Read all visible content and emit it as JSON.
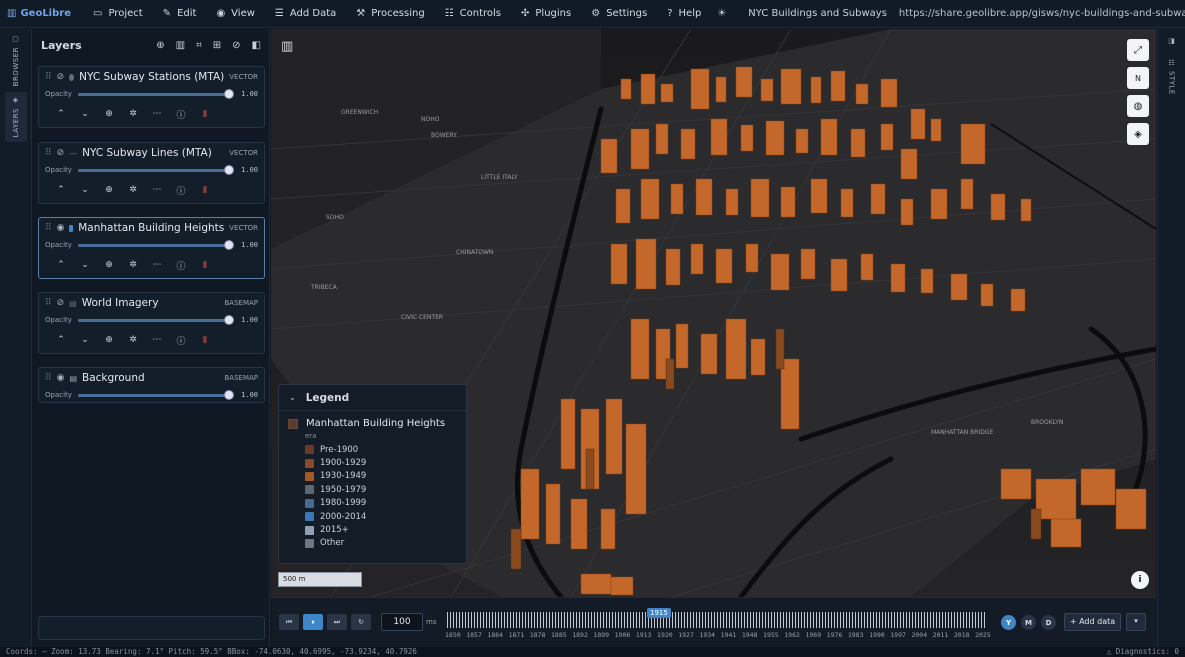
{
  "app": {
    "brand": "GeoLibre"
  },
  "menu": [
    {
      "label": "Project",
      "icon": "folder-icon"
    },
    {
      "label": "Edit",
      "icon": "pencil-icon"
    },
    {
      "label": "View",
      "icon": "eye-icon"
    },
    {
      "label": "Add Data",
      "icon": "database-icon"
    },
    {
      "label": "Processing",
      "icon": "wrench-icon"
    },
    {
      "label": "Controls",
      "icon": "sliders-icon"
    },
    {
      "label": "Plugins",
      "icon": "puzzle-icon"
    },
    {
      "label": "Settings",
      "icon": "gear-icon"
    },
    {
      "label": "Help",
      "icon": "help-icon"
    }
  ],
  "share": {
    "title": "NYC Buildings and Subways",
    "url": "https://share.geolibre.app/gisws/nyc-buildings-and-subways.geolibre.j..."
  },
  "leftrail": {
    "browser": "BROWSER",
    "layers": "LAYERS"
  },
  "panel": {
    "title": "Layers",
    "opacity_label": "Opacity"
  },
  "layers": [
    {
      "name": "NYC Subway Stations (MTA)",
      "type": "VECTOR",
      "opacity": "1.00",
      "opacity_value": 1.0,
      "visible": false,
      "swatch": "#666d77"
    },
    {
      "name": "NYC Subway Lines (MTA)",
      "type": "VECTOR",
      "opacity": "1.00",
      "opacity_value": 1.0,
      "visible": false,
      "swatch": "#666d77"
    },
    {
      "name": "Manhattan Building Heights",
      "type": "VECTOR",
      "opacity": "1.00",
      "opacity_value": 1.0,
      "visible": true,
      "swatch": "#3f86c8"
    },
    {
      "name": "World Imagery",
      "type": "BASEMAP",
      "opacity": "1.00",
      "opacity_value": 1.0,
      "visible": false,
      "swatch": "#666d77"
    },
    {
      "name": "Background",
      "type": "BASEMAP",
      "opacity": "1.00",
      "opacity_value": 1.0,
      "visible": true,
      "swatch": "#666d77"
    }
  ],
  "rightrail": {
    "style": "STYLE"
  },
  "map_labels": [
    "GREENWICH",
    "NOHO",
    "BOWERY",
    "SOHO",
    "LITTLE ITALY",
    "TRIBECA",
    "CHINATOWN",
    "CIVIC CENTER",
    "MANHATTAN BRIDGE",
    "BROOKLYN"
  ],
  "legend": {
    "header": "Legend",
    "layer": "Manhattan Building Heights",
    "field": "era",
    "items": [
      {
        "label": "Pre-1900",
        "color": "#6b3a26"
      },
      {
        "label": "1900-1929",
        "color": "#8a4a26"
      },
      {
        "label": "1930-1949",
        "color": "#a45a24"
      },
      {
        "label": "1950-1979",
        "color": "#5d6673"
      },
      {
        "label": "1980-1999",
        "color": "#476b93"
      },
      {
        "label": "2000-2014",
        "color": "#3b78b4"
      },
      {
        "label": "2015+",
        "color": "#8fa0b4"
      },
      {
        "label": "Other",
        "color": "#6f7782"
      }
    ]
  },
  "scale": "500 m",
  "timeline": {
    "speed": "100",
    "unit": "ms",
    "marker": "1915",
    "years": [
      "1850",
      "1857",
      "1864",
      "1871",
      "1878",
      "1885",
      "1892",
      "1899",
      "1906",
      "1913",
      "1920",
      "1927",
      "1934",
      "1941",
      "1948",
      "1955",
      "1962",
      "1969",
      "1976",
      "1983",
      "1990",
      "1997",
      "2004",
      "2011",
      "2018",
      "2025"
    ],
    "granularity": [
      "Y",
      "M",
      "D"
    ],
    "add_data": "+ Add data"
  },
  "status": {
    "left": "Coords: —   Zoom: 13.73   Bearing: 7.1°   Pitch: 59.5°   BBox: -74.0630, 40.6995, -73.9234, 40.7926",
    "right": "△ Diagnostics: 0"
  }
}
